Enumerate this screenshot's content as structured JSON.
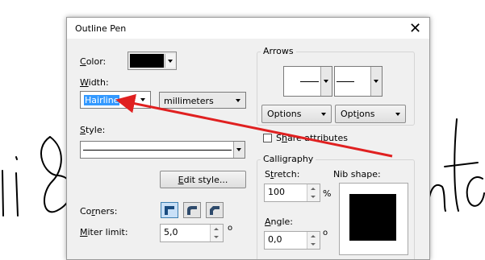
{
  "background": {
    "text_left": "ni 8",
    "text_right": "nta"
  },
  "dialog": {
    "title": "Outline Pen",
    "close_glyph": "✕",
    "color": {
      "label_key": "C",
      "label_rest": "olor:",
      "swatch": "#000000"
    },
    "width": {
      "label_key": "W",
      "label_rest": "idth:",
      "value": "Hairline",
      "units": "millimeters"
    },
    "style": {
      "label_key": "S",
      "label_rest": "tyle:"
    },
    "edit_style": {
      "key": "E",
      "rest": "dit style..."
    },
    "corners": {
      "label_pre": "Co",
      "label_key": "r",
      "label_rest": "ners:"
    },
    "miter": {
      "label_key": "M",
      "label_rest": "iter limit:",
      "value": "5,0",
      "unit": "o"
    },
    "arrows": {
      "title": "Arrows",
      "options_left": "Options",
      "options_right_pre": "Opt",
      "options_right_key": "i",
      "options_right_rest": "ons",
      "share_pre": "S",
      "share_key": "h",
      "share_rest": "are attributes"
    },
    "calligraphy": {
      "title": "Calligraphy",
      "stretch_label_key": "t",
      "stretch_label_pre": "S",
      "stretch_label_rest": "retch:",
      "stretch_value": "100",
      "stretch_unit": "%",
      "nib_label": "Nib shape:",
      "angle_label_key": "A",
      "angle_label_rest": "ngle:",
      "angle_value": "0,0",
      "angle_unit": "o"
    }
  },
  "colors": {
    "accent": "#3399ff",
    "arrow": "#e02020"
  }
}
